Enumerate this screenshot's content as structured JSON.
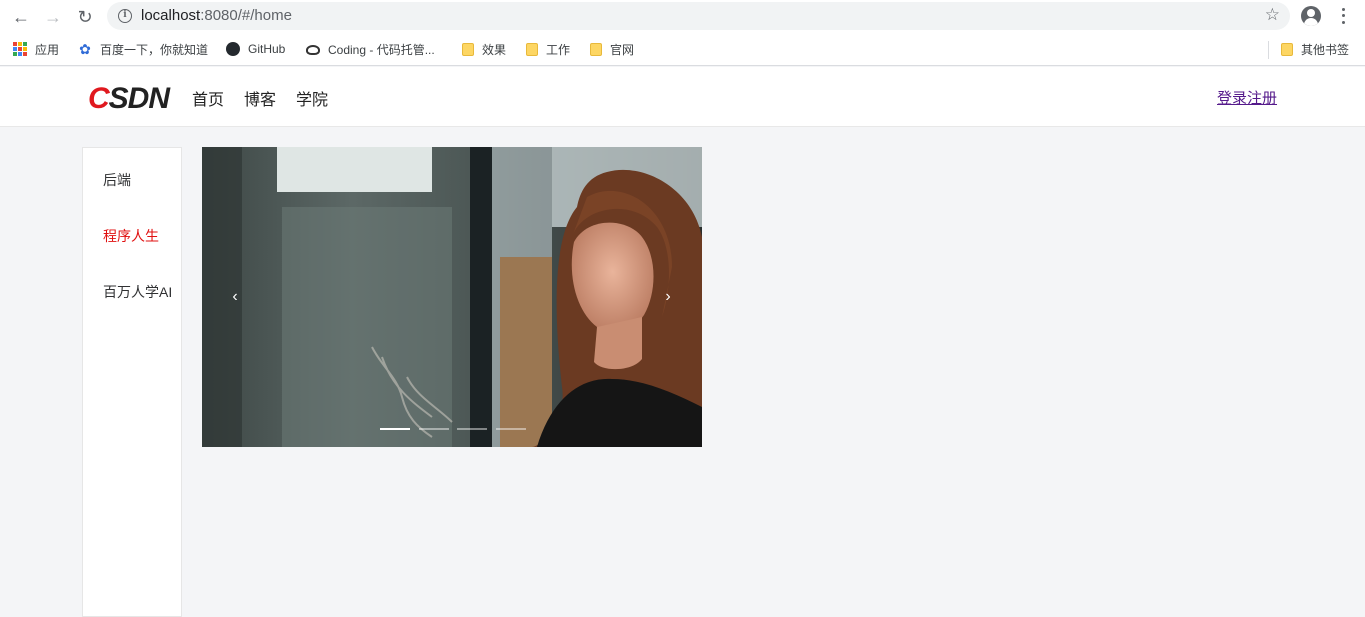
{
  "browser": {
    "url_host": "localhost",
    "url_rest": ":8080/#/home"
  },
  "bookmarks": [
    {
      "label": "应用",
      "icon": "apps-grid-icon"
    },
    {
      "label": "百度一下，你就知道",
      "icon": "baidu-paw-icon"
    },
    {
      "label": "GitHub",
      "icon": "github-icon"
    },
    {
      "label": "Coding - 代码托管...",
      "icon": "coding-icon"
    },
    {
      "label": "效果",
      "icon": "folder-icon"
    },
    {
      "label": "工作",
      "icon": "folder-icon"
    },
    {
      "label": "官网",
      "icon": "folder-icon"
    },
    {
      "label": "其他书签",
      "icon": "folder-icon"
    }
  ],
  "header": {
    "logo_text": "CSDN",
    "nav": [
      "首页",
      "博客",
      "学院"
    ],
    "login_label": "登录注册"
  },
  "sidebar": {
    "items": [
      {
        "label": "后端",
        "active": false
      },
      {
        "label": "程序人生",
        "active": true
      },
      {
        "label": "百万人学AI",
        "active": false
      }
    ]
  },
  "carousel": {
    "prev_glyph": "‹",
    "next_glyph": "›",
    "slide_count": 4,
    "active_index": 0
  },
  "colors": {
    "brand_red": "#e0191f",
    "active_menu": "#e01010",
    "link_visited": "#551a8b"
  }
}
